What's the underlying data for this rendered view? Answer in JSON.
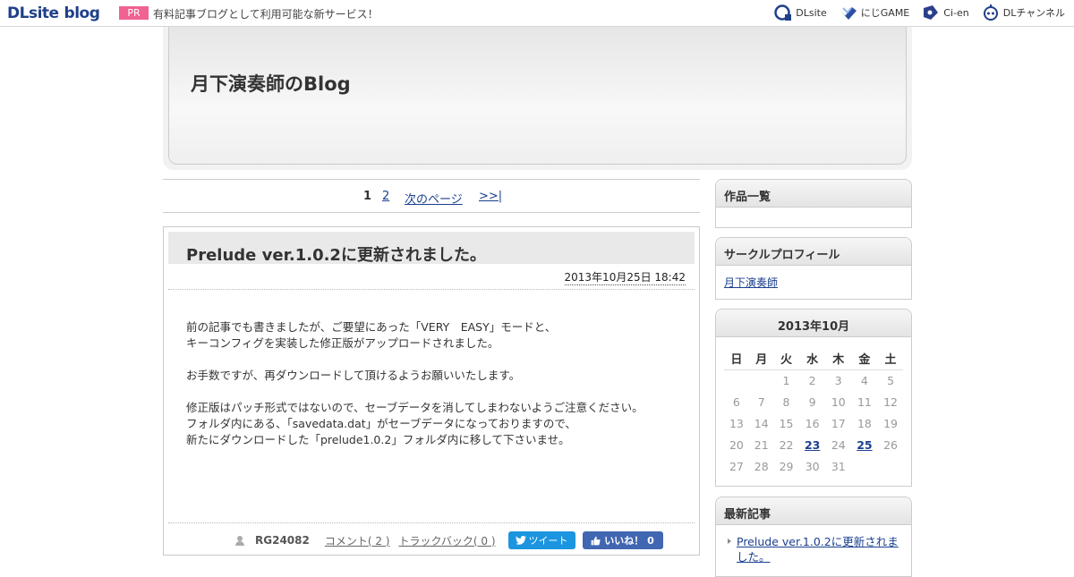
{
  "topbar": {
    "logo_main": "DLsite",
    "logo_blog": "blog",
    "pr_badge": "PR",
    "pr_text": "有料記事ブログとして利用可能な新サービス！",
    "links": [
      {
        "label": "DLsite",
        "icon": "dlsite-icon"
      },
      {
        "label": "にじGAME",
        "icon": "niji-game-icon"
      },
      {
        "label": "Ci-en",
        "icon": "ci-en-icon"
      },
      {
        "label": "DLチャンネル",
        "icon": "dl-channel-icon"
      }
    ]
  },
  "header": {
    "blog_title": "月下演奏師のBlog"
  },
  "pager": {
    "current": "1",
    "page2": "2",
    "next": "次のページ",
    "last": ">>|"
  },
  "article": {
    "title": "Prelude ver.1.0.2に更新されました。",
    "date": "2013年10月25日 18:42",
    "paragraphs": [
      [
        "前の記事でも書きましたが、ご要望にあった「VERY　EASY」モードと、",
        "キーコンフィグを実装した修正版がアップロードされました。"
      ],
      [
        "お手数ですが、再ダウンロードして頂けるようお願いいたします。"
      ],
      [
        "修正版はパッチ形式ではないので、セーブデータを消してしまわないようご注意ください。",
        "フォルダ内にある、「savedata.dat」がセーブデータになっておりますので、",
        "新たにダウンロードした「prelude1.0.2」フォルダ内に移して下さいませ。"
      ]
    ],
    "author": "RG24082",
    "comment_link": "コメント( 2 )",
    "trackback_link": "トラックバック( 0 )",
    "tweet_label": "ツイート",
    "like_label": "いいね！ 0"
  },
  "sidebar": {
    "works_title": "作品一覧",
    "profile_title": "サークルプロフィール",
    "profile_link": "月下演奏師",
    "calendar_title": "2013年10月",
    "calendar_weekdays": [
      "日",
      "月",
      "火",
      "水",
      "木",
      "金",
      "土"
    ],
    "calendar_weeks": [
      [
        "",
        "",
        "1",
        "2",
        "3",
        "4",
        "5"
      ],
      [
        "6",
        "7",
        "8",
        "9",
        "10",
        "11",
        "12"
      ],
      [
        "13",
        "14",
        "15",
        "16",
        "17",
        "18",
        "19"
      ],
      [
        "20",
        "21",
        "22",
        "23",
        "24",
        "25",
        "26"
      ],
      [
        "27",
        "28",
        "29",
        "30",
        "31",
        "",
        ""
      ]
    ],
    "calendar_links": [
      "23",
      "25"
    ],
    "recent_title": "最新記事",
    "recent_items": [
      "Prelude ver.1.0.2に更新されました。"
    ]
  }
}
